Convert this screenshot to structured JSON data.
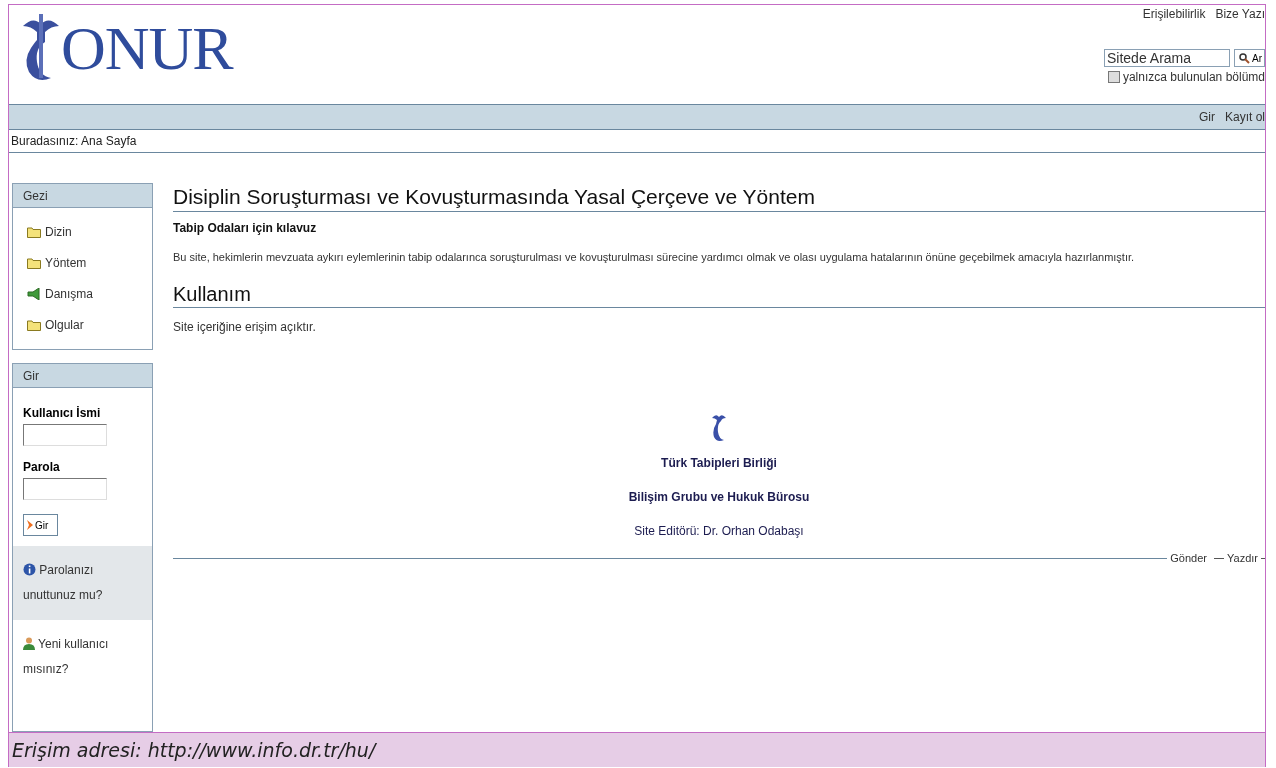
{
  "header": {
    "logo_text": "ONUR",
    "top_links": [
      "Erişilebilirlik",
      "Bize Yazı"
    ],
    "search": {
      "placeholder": "Sitede Arama",
      "button": "Ar"
    },
    "search_option": {
      "label": "yalnızca bulunulan bölümd",
      "checked": false
    }
  },
  "nav_bar": {
    "links": [
      "Gir",
      "Kayıt ol"
    ]
  },
  "breadcrumb": "Buradasınız: Ana Sayfa",
  "sidebar": {
    "navigation": {
      "title": "Gezi",
      "items": [
        {
          "label": "Dizin",
          "kind": "folder"
        },
        {
          "label": "Yöntem",
          "kind": "folder"
        },
        {
          "label": "Danışma",
          "kind": "page"
        },
        {
          "label": "Olgular",
          "kind": "folder"
        }
      ]
    },
    "login": {
      "title": "Gir",
      "fields": [
        {
          "label": "Kullanıcı İsmi"
        },
        {
          "label": "Parola"
        }
      ],
      "button": "Gir",
      "links": [
        {
          "text": "Parolanızı unuttunuz mu?",
          "kind": "info"
        },
        {
          "text": "Yeni kullanıcı mısınız?",
          "kind": "user"
        }
      ]
    }
  },
  "main": {
    "title": "Disiplin Soruşturması ve Kovuşturmasında Yasal Çerçeve ve Yöntem",
    "description": "Tabip Odaları için kılavuz",
    "body": "Bu site, hekimlerin mevzuata aykırı eylemlerinin tabip odalarınca soruşturulması ve kovuşturulması sürecine yardımcı olmak ve olası uygulama hatalarının önüne geçebilmek amacıyla hazırlanmıştır.",
    "section_title": "Kullanım",
    "section_text": "Site içeriğine erişim açıktır.",
    "credits": [
      {
        "text": "Türk Tabipleri Birliği",
        "bold": true
      },
      {
        "text": "Bilişim Grubu ve Hukuk Bürosu",
        "bold": true
      },
      {
        "text": "Site Editörü: Dr. Orhan Odabaşı",
        "bold": false
      }
    ],
    "actions": [
      "Gönder",
      "Yazdır"
    ]
  },
  "caption": "Erişim adresi: http://www.info.dr.tr/hu/"
}
